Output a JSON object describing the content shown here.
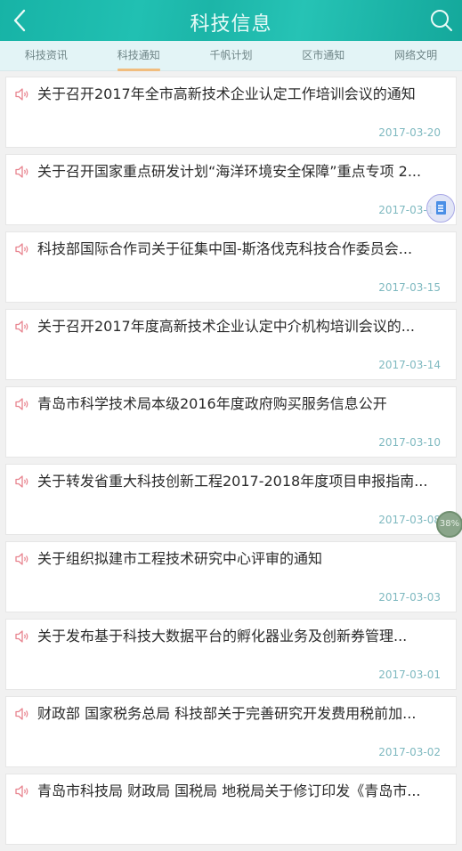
{
  "header": {
    "title": "科技信息",
    "back_icon": "chevron-left-icon",
    "search_icon": "search-icon"
  },
  "tabs": [
    {
      "label": "科技资讯",
      "active": false
    },
    {
      "label": "科技通知",
      "active": true
    },
    {
      "label": "千帆计划",
      "active": false
    },
    {
      "label": "区市通知",
      "active": false
    },
    {
      "label": "网络文明",
      "active": false
    }
  ],
  "items": [
    {
      "title": "关于召开2017年全市高新技术企业认定工作培训会议的通知",
      "date": "2017-03-20"
    },
    {
      "title": "关于召开国家重点研发计划“海洋环境安全保障”重点专项 2...",
      "date": "2017-03-17"
    },
    {
      "title": "科技部国际合作司关于征集中国-斯洛伐克科技合作委员会...",
      "date": "2017-03-15"
    },
    {
      "title": "关于召开2017年度高新技术企业认定中介机构培训会议的...",
      "date": "2017-03-14"
    },
    {
      "title": "青岛市科学技术局本级2016年度政府购买服务信息公开",
      "date": "2017-03-10"
    },
    {
      "title": "关于转发省重大科技创新工程2017-2018年度项目申报指南...",
      "date": "2017-03-08"
    },
    {
      "title": "关于组织拟建市工程技术研究中心评审的通知",
      "date": "2017-03-03"
    },
    {
      "title": "关于发布基于科技大数据平台的孵化器业务及创新券管理...",
      "date": "2017-03-01"
    },
    {
      "title": "财政部 国家税务总局 科技部关于完善研究开发费用税前加...",
      "date": "2017-03-02"
    },
    {
      "title": "青岛市科技局 财政局 国税局 地税局关于修订印发《青岛市...",
      "date": ""
    }
  ],
  "floating": {
    "doc_icon": "document-icon",
    "progress_label": "38%",
    "progress_value": 38
  },
  "colors": {
    "header": "#1cb5a8",
    "tab_bar": "#e3f4f6",
    "tab_indicator": "#f1bd7e",
    "speaker": "#e8848f",
    "date": "#7fb9c0"
  }
}
